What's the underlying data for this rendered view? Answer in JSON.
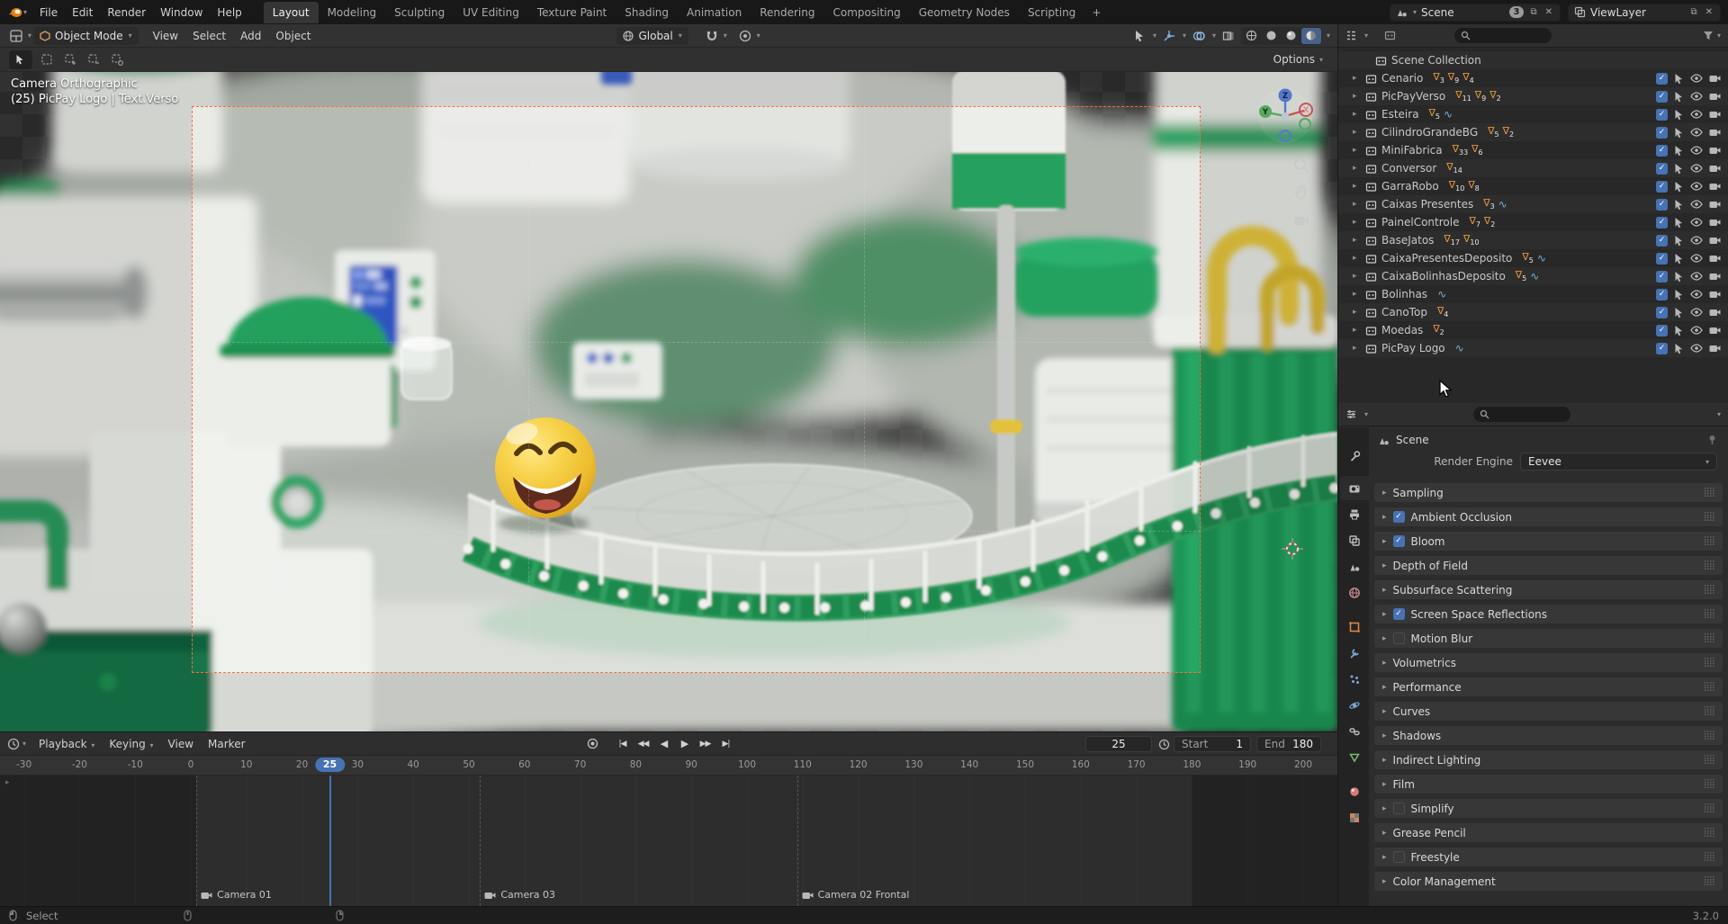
{
  "topbar": {
    "menus": [
      "File",
      "Edit",
      "Render",
      "Window",
      "Help"
    ],
    "workspaces": [
      "Layout",
      "Modeling",
      "Sculpting",
      "UV Editing",
      "Texture Paint",
      "Shading",
      "Animation",
      "Rendering",
      "Compositing",
      "Geometry Nodes",
      "Scripting"
    ],
    "active_workspace": "Layout",
    "add_workspace_label": "+",
    "scene_field": {
      "value": "Scene",
      "badge": "3"
    },
    "viewlayer_field": {
      "value": "ViewLayer"
    }
  },
  "viewport": {
    "header": {
      "mode": "Object Mode",
      "menus": [
        "View",
        "Select",
        "Add",
        "Object"
      ],
      "orientation": "Global"
    },
    "tool_settings": {
      "options_label": "Options"
    },
    "overlay": {
      "line1": "Camera Orthographic",
      "line2": "(25) PicPay Logo | Text.Verso"
    },
    "gizmo": {
      "x": "X",
      "y": "Y",
      "z": "Z"
    }
  },
  "outliner": {
    "root": "Scene Collection",
    "items": [
      {
        "name": "Cenario",
        "counts": [
          3,
          9,
          4
        ],
        "curve": false
      },
      {
        "name": "PicPayVerso",
        "counts": [
          11,
          9,
          2
        ],
        "curve": false
      },
      {
        "name": "Esteira",
        "counts": [
          5
        ],
        "curve": true
      },
      {
        "name": "CilindroGrandeBG",
        "counts": [
          5,
          2
        ],
        "curve": false
      },
      {
        "name": "MiniFabrica",
        "counts": [
          33,
          6
        ],
        "curve": false
      },
      {
        "name": "Conversor",
        "counts": [
          14
        ],
        "curve": false
      },
      {
        "name": "GarraRobo",
        "counts": [
          10,
          8
        ],
        "curve": false
      },
      {
        "name": "Caixas Presentes",
        "counts": [
          3
        ],
        "curve": true
      },
      {
        "name": "PainelControle",
        "counts": [
          7,
          2
        ],
        "curve": false
      },
      {
        "name": "BaseJatos",
        "counts": [
          17,
          10
        ],
        "curve": false
      },
      {
        "name": "CaixaPresentesDeposito",
        "counts": [
          5
        ],
        "curve": true
      },
      {
        "name": "CaixaBolinhasDeposito",
        "counts": [
          5
        ],
        "curve": true
      },
      {
        "name": "Bolinhas",
        "counts": [],
        "curve": true
      },
      {
        "name": "CanoTop",
        "counts": [
          4
        ],
        "curve": false
      },
      {
        "name": "Moedas",
        "counts": [
          2
        ],
        "curve": false
      },
      {
        "name": "PicPay Logo",
        "counts": [],
        "curve": true
      }
    ]
  },
  "properties": {
    "breadcrumb": "Scene",
    "render_engine_label": "Render Engine",
    "render_engine_value": "Eevee",
    "tabs": [
      "tool",
      "render",
      "output",
      "view-layer",
      "scene",
      "world",
      "object",
      "modifiers",
      "particles",
      "physics",
      "constraints",
      "data",
      "material",
      "texture"
    ],
    "active_tab": "render",
    "sections": [
      {
        "label": "Sampling",
        "checkbox": null
      },
      {
        "label": "Ambient Occlusion",
        "checkbox": true
      },
      {
        "label": "Bloom",
        "checkbox": true
      },
      {
        "label": "Depth of Field",
        "checkbox": null
      },
      {
        "label": "Subsurface Scattering",
        "checkbox": null
      },
      {
        "label": "Screen Space Reflections",
        "checkbox": true
      },
      {
        "label": "Motion Blur",
        "checkbox": false
      },
      {
        "label": "Volumetrics",
        "checkbox": null
      },
      {
        "label": "Performance",
        "checkbox": null
      },
      {
        "label": "Curves",
        "checkbox": null
      },
      {
        "label": "Shadows",
        "checkbox": null
      },
      {
        "label": "Indirect Lighting",
        "checkbox": null
      },
      {
        "label": "Film",
        "checkbox": null
      },
      {
        "label": "Simplify",
        "checkbox": false
      },
      {
        "label": "Grease Pencil",
        "checkbox": null
      },
      {
        "label": "Freestyle",
        "checkbox": false
      },
      {
        "label": "Color Management",
        "checkbox": null
      }
    ]
  },
  "timeline": {
    "menus": [
      "Playback",
      "Keying",
      "View",
      "Marker"
    ],
    "current_frame": "25",
    "start_label": "Start",
    "start_value": "1",
    "end_label": "End",
    "end_value": "180",
    "tick_start": -30,
    "tick_end": 200,
    "tick_step": 10,
    "markers": [
      {
        "label": "Camera 01",
        "frame": 1
      },
      {
        "label": "Camera 03",
        "frame": 52
      },
      {
        "label": "Camera 02 Frontal",
        "frame": 109
      }
    ]
  },
  "statusbar": {
    "mode_hint": "Select",
    "version": "3.2.0"
  }
}
